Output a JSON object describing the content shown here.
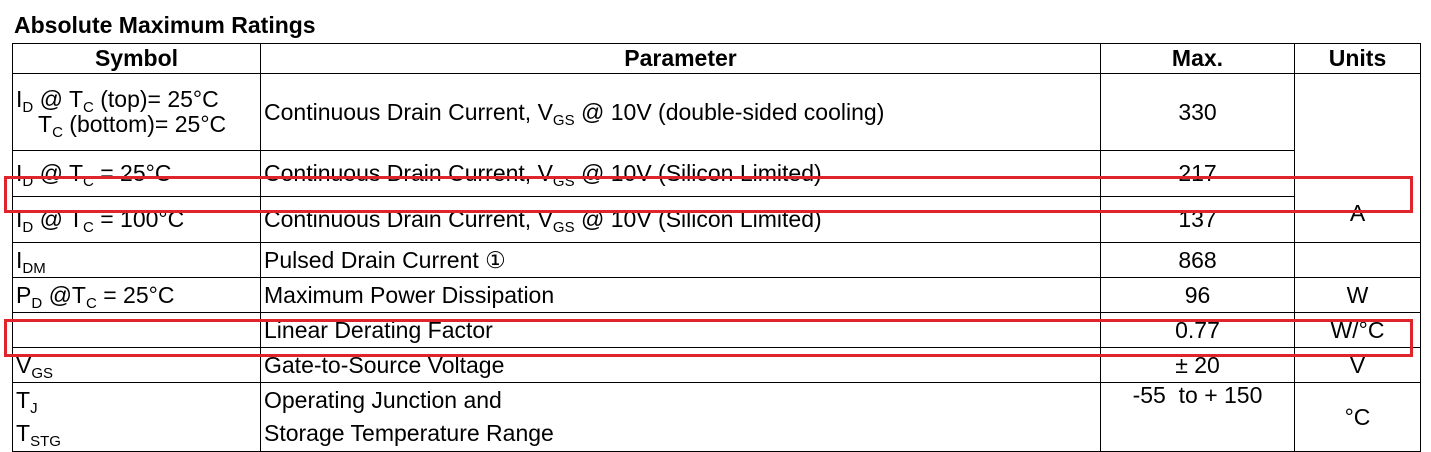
{
  "title": "Absolute Maximum Ratings",
  "headers": {
    "symbol": "Symbol",
    "parameter": "Parameter",
    "max": "Max.",
    "units": "Units"
  },
  "rows": [
    {
      "sym_main": "I",
      "sym_sub": "D",
      "sym_mid": " @ T",
      "sym_sub2": "C",
      "sym_tail": " (top)= 25°C",
      "sym2_main": "T",
      "sym2_sub": "C",
      "sym2_tail": " (bottom)= 25°C",
      "param_pre": "Continuous Drain Current, V",
      "param_sub": "GS",
      "param_post": " @ 10V (double-sided cooling)",
      "max": "330"
    },
    {
      "sym_main": "I",
      "sym_sub": "D",
      "sym_mid": " @ T",
      "sym_sub2": "C",
      "sym_tail": " = 25°C",
      "param_pre": "Continuous Drain Current, V",
      "param_sub": "GS",
      "param_post": " @ 10V (Silicon Limited)",
      "max": "217"
    },
    {
      "sym_main": "I",
      "sym_sub": "D",
      "sym_mid": " @ T",
      "sym_sub2": "C",
      "sym_tail": " = 100°C",
      "param_pre": "Continuous Drain Current, V",
      "param_sub": "GS",
      "param_post": " @ 10V (Silicon Limited)",
      "max": "137",
      "units": "A"
    },
    {
      "sym_main": "I",
      "sym_sub": "DM",
      "param": "Pulsed Drain Current ①",
      "max": "868"
    },
    {
      "sym_main": "P",
      "sym_sub": "D",
      "sym_mid": " @T",
      "sym_sub2": "C",
      "sym_tail": " = 25°C",
      "param": "Maximum Power Dissipation",
      "max": "96",
      "units": "W"
    },
    {
      "param": "Linear Derating Factor",
      "max": "0.77",
      "units": "W/°C"
    },
    {
      "sym_main": "V",
      "sym_sub": "GS",
      "param": "Gate-to-Source Voltage",
      "max": "± 20",
      "units": "V"
    },
    {
      "sym_main": "T",
      "sym_sub": "J",
      "sym2_main": "T",
      "sym2_sub": "STG",
      "param": "Operating Junction and",
      "param2": "Storage Temperature Range",
      "max": "-55  to + 150",
      "units": "°C"
    }
  ],
  "highlight_color": "#e0242c"
}
